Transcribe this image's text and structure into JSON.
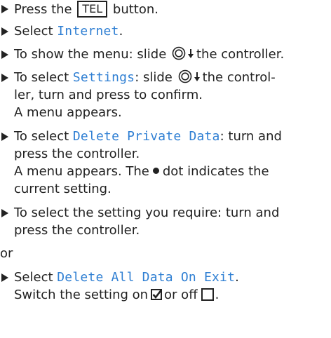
{
  "steps": {
    "s1": {
      "before": "Press the",
      "key": "TEL",
      "after": "button."
    },
    "s2": {
      "before": "Select",
      "code": "Internet",
      "after": "."
    },
    "s3": {
      "before": "To show the menu: slide",
      "after": "the controller."
    },
    "s4": {
      "before": "To select",
      "code": "Settings",
      "mid": ": slide",
      "after": "the control-",
      "line2": "ler, turn and press to confirm.",
      "line3": "A menu appears."
    },
    "s5": {
      "before": "To select",
      "code": "Delete Private Data",
      "after": ": turn and",
      "line2": "press the controller.",
      "line3_before": "A menu appears. The",
      "line3_after": "dot indicates the",
      "line4": "current setting."
    },
    "s6": {
      "line1": "To select the setting you require: turn and",
      "line2": "press the controller."
    },
    "or": "or",
    "s7": {
      "before": "Select",
      "code": "Delete All Data On Exit",
      "after": ".",
      "line2_before": "Switch the setting on",
      "line2_mid": "or off",
      "line2_after": "."
    }
  },
  "icons": {
    "bullet": "triangle-right-icon",
    "controller": "controller-icon",
    "slide_down": "arrow-down-icon",
    "dot": "filled-dot-icon",
    "checkbox_on": "checkbox-checked-icon",
    "checkbox_off": "checkbox-empty-icon"
  },
  "colors": {
    "text": "#222222",
    "code_highlight": "#2f7fd3"
  }
}
